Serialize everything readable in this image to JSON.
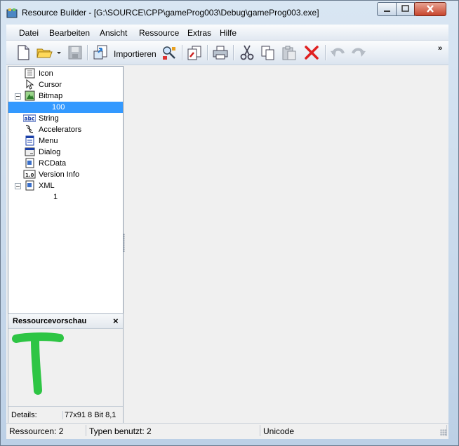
{
  "window": {
    "title": "Resource Builder - [G:\\SOURCE\\CPP\\gameProg003\\Debug\\gameProg003.exe]"
  },
  "menu": [
    "Datei",
    "Bearbeiten",
    "Ansicht",
    "Ressource",
    "Extras",
    "Hilfe"
  ],
  "toolbar": {
    "import_label": "Importieren",
    "overflow": "»",
    "icons": [
      "new-file-icon",
      "open-folder-icon",
      "dropdown-arrow-icon",
      "save-icon",
      "import-icon",
      "resource-wizard-icon",
      "copy-resource-icon",
      "print-icon",
      "cut-icon",
      "copy-icon",
      "paste-icon",
      "delete-icon",
      "undo-icon",
      "redo-icon"
    ]
  },
  "tree": [
    {
      "label": "Icon",
      "icon": "icon-resource-icon"
    },
    {
      "label": "Cursor",
      "icon": "cursor-resource-icon"
    },
    {
      "label": "Bitmap",
      "icon": "bitmap-resource-icon",
      "expanded": true
    },
    {
      "label": "100",
      "selected": true
    },
    {
      "label": "String",
      "icon": "string-resource-icon"
    },
    {
      "label": "Accelerators",
      "icon": "accelerator-resource-icon"
    },
    {
      "label": "Menu",
      "icon": "menu-resource-icon"
    },
    {
      "label": "Dialog",
      "icon": "dialog-resource-icon"
    },
    {
      "label": "RCData",
      "icon": "rcdata-resource-icon"
    },
    {
      "label": "Version Info",
      "icon": "version-info-icon"
    },
    {
      "label": "XML",
      "icon": "xml-resource-icon",
      "expanded": true
    },
    {
      "label": "1"
    }
  ],
  "preview": {
    "title": "Ressourcevorschau",
    "close": "×",
    "details_label": "Details:",
    "details_value": "77x91 8 Bit 8,1",
    "image_color": "#2ec544"
  },
  "status": {
    "resources": "Ressourcen: 2",
    "types": "Typen benutzt: 2",
    "encoding": "Unicode"
  },
  "colors": {
    "selection": "#3399ff",
    "delete": "#e02020"
  }
}
